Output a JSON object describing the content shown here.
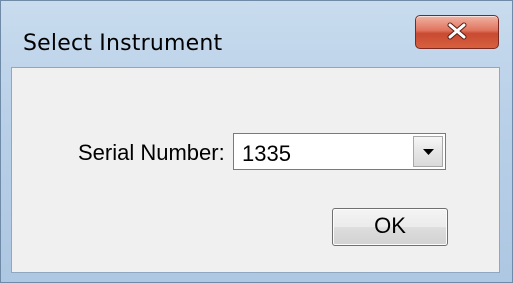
{
  "window": {
    "title": "Select Instrument",
    "close_icon": "close-icon"
  },
  "form": {
    "serial_label": "Serial Number:",
    "serial_value": "1335",
    "dropdown_icon": "chevron-down-icon"
  },
  "buttons": {
    "ok_label": "OK"
  },
  "colors": {
    "close_button": "#d8603e",
    "frame": "#b9d0e8",
    "client_background": "#f0f0f0"
  }
}
